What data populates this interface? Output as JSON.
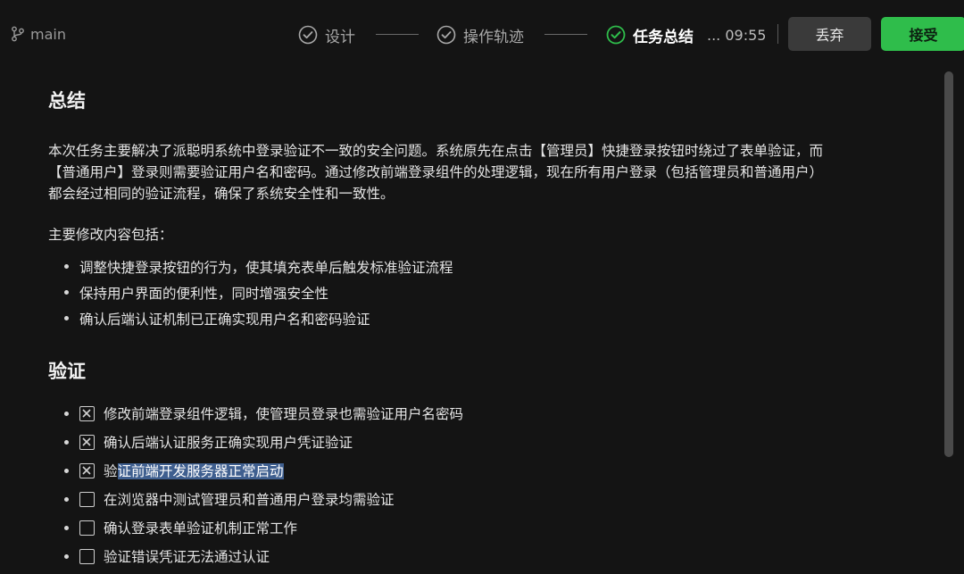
{
  "header": {
    "branch": "main",
    "steps": [
      {
        "label": "设计",
        "state": "done"
      },
      {
        "label": "操作轨迹",
        "state": "done"
      },
      {
        "label": "任务总结",
        "state": "active"
      }
    ],
    "timer": "... 09:55",
    "discard_label": "丢弃",
    "accept_label": "接受"
  },
  "summary": {
    "heading": "总结",
    "paragraph_lines": [
      "本次任务主要解决了派聪明系统中登录验证不一致的安全问题。系统原先在点击【管理员】快捷登录按钮时绕过了表单验证，而",
      "【普通用户】登录则需要验证用户名和密码。通过修改前端登录组件的处理逻辑，现在所有用户登录（包括管理员和普通用户）",
      "都会经过相同的验证流程，确保了系统安全性和一致性。"
    ],
    "changes_intro": "主要修改内容包括：",
    "changes": [
      "调整快捷登录按钮的行为，使其填充表单后触发标准验证流程",
      "保持用户界面的便利性，同时增强安全性",
      "确认后端认证机制已正确实现用户名和密码验证"
    ]
  },
  "verification": {
    "heading": "验证",
    "items": [
      {
        "text": "修改前端登录组件逻辑，使管理员登录也需验证用户名密码",
        "checked": true
      },
      {
        "text": "确认后端认证服务正确实现用户凭证验证",
        "checked": true
      },
      {
        "text_plain": "验",
        "text_selected": "证前端开发服务器正常启动",
        "checked": true
      },
      {
        "text": "在浏览器中测试管理员和普通用户登录均需验证",
        "checked": false
      },
      {
        "text": "确认登录表单验证机制正常工作",
        "checked": false
      },
      {
        "text": "验证错误凭证无法通过认证",
        "checked": false
      }
    ]
  },
  "colors": {
    "background": "#141414",
    "accent_green": "#2fbd4b",
    "selection": "#3f5f8f"
  },
  "icons": {
    "branch": "git-branch-icon",
    "step_done": "check-circle-icon",
    "step_active": "check-circle-green-icon",
    "checkbox_checked": "checkbox-x-icon",
    "checkbox_empty": "checkbox-empty-icon"
  }
}
